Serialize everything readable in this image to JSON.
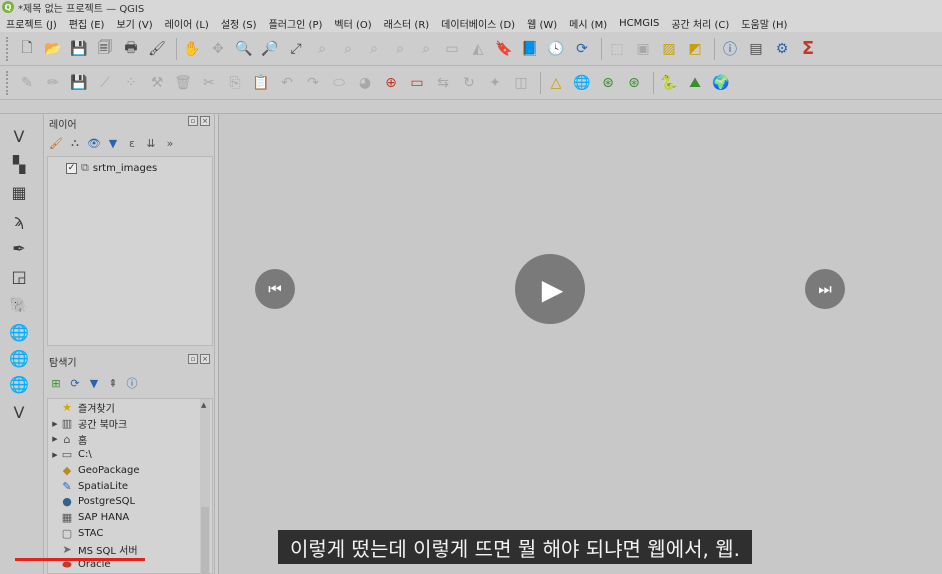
{
  "window": {
    "title": "*제목 없는 프로젝트 — QGIS",
    "logo": "Q"
  },
  "menu": [
    "프로젝트 (J)",
    "편집 (E)",
    "보기 (V)",
    "레이어 (L)",
    "설정 (S)",
    "플러그인 (P)",
    "벡터 (O)",
    "래스터 (R)",
    "데이터베이스 (D)",
    "웹 (W)",
    "메시 (M)",
    "HCMGIS",
    "공간 처리 (C)",
    "도움말 (H)"
  ],
  "toolbar": {
    "sigma": "Σ"
  },
  "layers_panel": {
    "title": "레이어",
    "items": [
      {
        "label": "srtm_images",
        "checked": "✓"
      }
    ]
  },
  "browser_panel": {
    "title": "탐색기",
    "items": [
      {
        "label": "즐겨찾기",
        "icon": "star-icon",
        "glyph": "★",
        "color": "#d4a800",
        "expand": ""
      },
      {
        "label": "공간 북마크",
        "icon": "bookmark-icon",
        "glyph": "▥",
        "color": "#555555",
        "expand": "▶"
      },
      {
        "label": "홈",
        "icon": "home-folder-icon",
        "glyph": "⌂",
        "color": "#555555",
        "expand": "▶"
      },
      {
        "label": "C:\\",
        "icon": "drive-folder-icon",
        "glyph": "▭",
        "color": "#555555",
        "expand": "▶"
      },
      {
        "label": "GeoPackage",
        "icon": "geopackage-icon",
        "glyph": "◆",
        "color": "#b58a1e",
        "expand": ""
      },
      {
        "label": "SpatiaLite",
        "icon": "spatialite-icon",
        "glyph": "✎",
        "color": "#2a64b0",
        "expand": ""
      },
      {
        "label": "PostgreSQL",
        "icon": "postgresql-icon",
        "glyph": "●",
        "color": "#33628c",
        "expand": ""
      },
      {
        "label": "SAP HANA",
        "icon": "sap-hana-icon",
        "glyph": "▦",
        "color": "#555555",
        "expand": ""
      },
      {
        "label": "STAC",
        "icon": "stac-icon",
        "glyph": "▢",
        "color": "#666666",
        "expand": ""
      },
      {
        "label": "MS SQL 서버",
        "icon": "mssql-icon",
        "glyph": "➤",
        "color": "#6a6a6a",
        "expand": ""
      },
      {
        "label": "Oracle",
        "icon": "oracle-icon",
        "glyph": "⬬",
        "color": "#c0392b",
        "expand": ""
      }
    ]
  },
  "player": {
    "prev_glyph": "⏮",
    "play_glyph": "▶",
    "next_glyph": "⏭",
    "progress": 0.138
  },
  "caption": "이렇게 떴는데 이렇게 뜨면 뭘 해야 되냐면 웹에서, 웹."
}
